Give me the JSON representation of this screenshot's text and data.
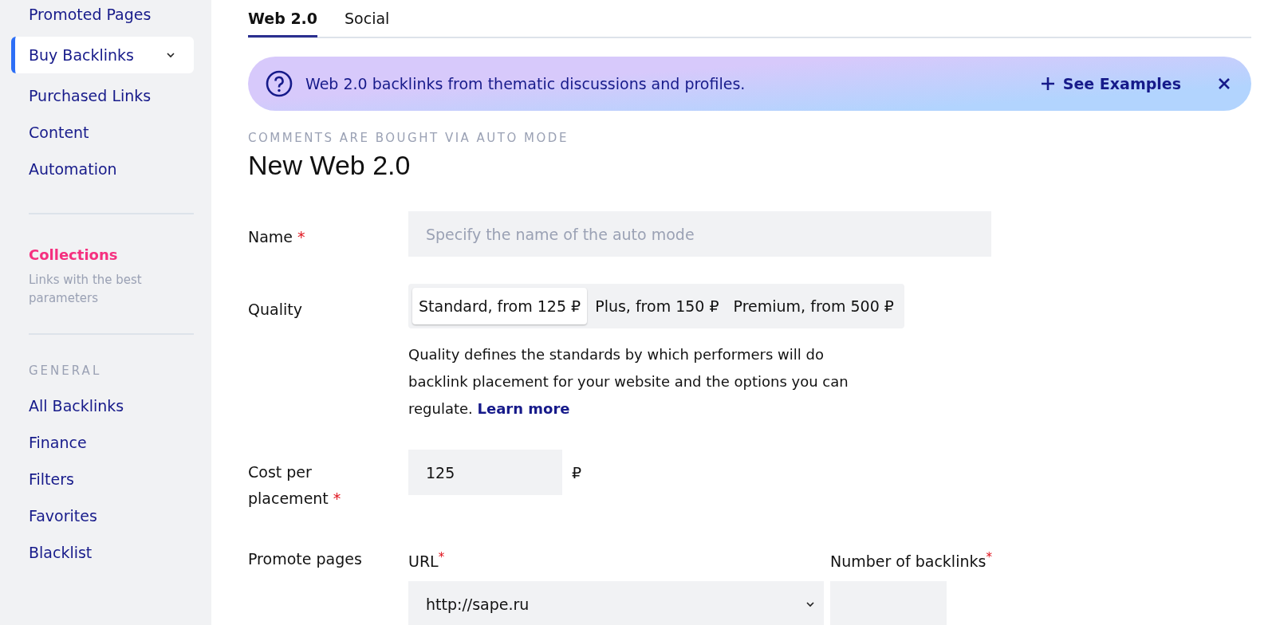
{
  "sidebar": {
    "items": [
      {
        "label": "Promoted Pages",
        "selected": false,
        "has_menu": false
      },
      {
        "label": "Buy Backlinks",
        "selected": true,
        "has_menu": true
      },
      {
        "label": "Purchased Links",
        "selected": false,
        "has_menu": false
      },
      {
        "label": "Content",
        "selected": false,
        "has_menu": false
      },
      {
        "label": "Automation",
        "selected": false,
        "has_menu": false
      }
    ],
    "collections": {
      "title": "Collections",
      "subtitle": "Links with the best parameters"
    },
    "general": {
      "heading": "GENERAL",
      "items": [
        {
          "label": "All Backlinks",
          "selected": false
        },
        {
          "label": "Finance",
          "selected": false
        },
        {
          "label": "Filters",
          "selected": false
        },
        {
          "label": "Favorites",
          "selected": false
        },
        {
          "label": "Blacklist",
          "selected": false
        }
      ]
    }
  },
  "tabs": [
    {
      "label": "Web 2.0",
      "selected": true
    },
    {
      "label": "Social",
      "selected": false
    }
  ],
  "banner": {
    "text": "Web 2.0 backlinks from thematic discussions and profiles.",
    "action": "See Examples"
  },
  "overline": "COMMENTS ARE BOUGHT VIA AUTO MODE",
  "title": "New Web 2.0",
  "form": {
    "name": {
      "label": "Name",
      "required_mark": "*",
      "placeholder": "Specify the name of the auto mode"
    },
    "quality": {
      "label": "Quality",
      "options": [
        {
          "label": "Standard, from 125 ₽",
          "selected": true
        },
        {
          "label": "Plus, from 150 ₽",
          "selected": false
        },
        {
          "label": "Premium, from 500 ₽",
          "selected": false
        }
      ],
      "description": "Quality defines the standards by which performers will do backlink placement for your website and the options you can regulate.",
      "link": "Learn more"
    },
    "cost": {
      "label": "Cost per placement",
      "required_mark": "*",
      "value": "125",
      "currency": "₽"
    },
    "promote": {
      "label": "Promote pages",
      "url": {
        "label": "URL",
        "required_mark": "*",
        "value": "http://sape.ru"
      },
      "count": {
        "label": "Number of backlinks",
        "required_mark": "*"
      }
    }
  }
}
